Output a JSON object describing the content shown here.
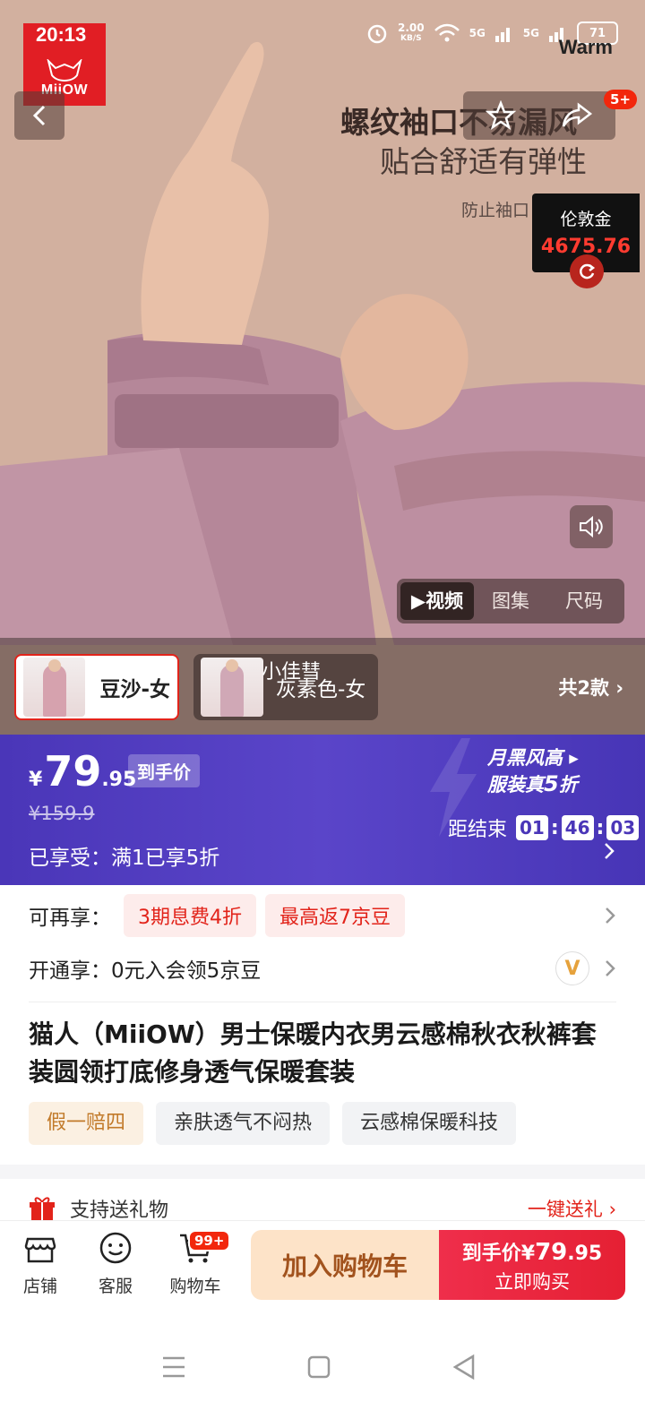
{
  "status_bar": {
    "time": "20:13",
    "speed_value": "2.00",
    "speed_unit": "KB/S",
    "net1": "5G",
    "net2": "5G",
    "battery": "71",
    "warm_label": "Warm"
  },
  "brand": {
    "logo_text": "MiiOW"
  },
  "hero": {
    "title_line1": "螺纹袖口不易漏风",
    "title_line2": "贴合舒适有弹性",
    "subtitle": "防止袖口",
    "notification_badge": "5+",
    "gold_widget": {
      "label": "伦敦金",
      "value": "4675.76"
    },
    "media_tabs": [
      {
        "label": "▶视频",
        "active": true
      },
      {
        "label": "图集",
        "active": false
      },
      {
        "label": "尺码",
        "active": false
      }
    ]
  },
  "variants": {
    "items": [
      {
        "label": "豆沙-女",
        "selected": true
      },
      {
        "label": "灰素色-女",
        "overlay": "小佳彗",
        "selected": false
      }
    ],
    "total_label": "共2款 ›"
  },
  "price": {
    "currency": "¥",
    "integer": "79",
    "decimal": ".95",
    "price_tag": "到手价",
    "original": "¥159.9",
    "enjoyed_label": "已享受：",
    "enjoyed_value": "满1已享5折",
    "promo_line1": "月黑风高 ▸",
    "promo_line2_prefix": "服装真",
    "promo_line2_num": "5",
    "promo_line2_suffix": "折",
    "countdown_label": "距结束",
    "countdown": [
      "01",
      "46",
      "03"
    ]
  },
  "benefits": {
    "extra_label": "可再享：",
    "extra_chips": [
      "3期息费4折",
      "最高返7京豆"
    ],
    "open_label": "开通享：",
    "open_value": "0元入会领5京豆",
    "vip_icon": "V"
  },
  "product": {
    "title": "猫人（MiiOW）男士保暖内衣男云感棉秋衣秋裤套装圆领打底修身透气保暖套装",
    "tags": [
      {
        "label": "假一赔四",
        "style": "gold"
      },
      {
        "label": "亲肤透气不闷热",
        "style": "gray"
      },
      {
        "label": "云感棉保暖科技",
        "style": "gray"
      }
    ]
  },
  "gift": {
    "label": "支持送礼物",
    "action": "一键送礼 ›"
  },
  "bottom_bar": {
    "shop": "店铺",
    "service": "客服",
    "cart": "购物车",
    "cart_badge": "99+",
    "add_to_cart": "加入购物车",
    "buy_price_prefix": "到手价¥",
    "buy_price_int": "79",
    "buy_price_dec": ".95",
    "buy_now": "立即购买"
  },
  "colors": {
    "accent_red": "#e2231a",
    "price_bar": "#4a36b8",
    "add_cart_bg": "#fde3c8",
    "buy_now_bg": "#e52033"
  }
}
